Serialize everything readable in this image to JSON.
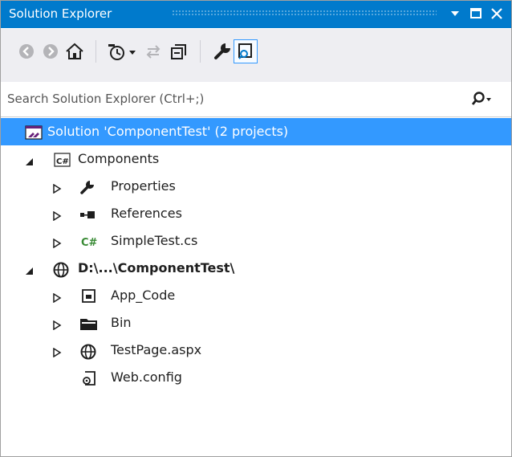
{
  "window": {
    "title": "Solution Explorer",
    "accent_color": "#007acc",
    "selection_color": "#3399ff"
  },
  "title_buttons": [
    {
      "name": "dropdown-arrow-icon"
    },
    {
      "name": "maximize-icon"
    },
    {
      "name": "close-icon"
    }
  ],
  "toolbar": {
    "buttons": [
      {
        "name": "back-icon"
      },
      {
        "name": "forward-icon"
      },
      {
        "name": "home-icon"
      },
      {
        "name": "pending-changes-filter-icon"
      },
      {
        "name": "sync-with-active-document-icon"
      },
      {
        "name": "collapse-all-icon"
      },
      {
        "name": "properties-wrench-icon"
      },
      {
        "name": "preview-selected-items-icon"
      }
    ]
  },
  "search": {
    "placeholder": "Search Solution Explorer (Ctrl+;)",
    "icon": "search-icon"
  },
  "tree": {
    "solution": {
      "label": "Solution 'ComponentTest' (2 projects)",
      "icon": "solution-icon",
      "selected": true
    },
    "projects": [
      {
        "label": "Components",
        "icon": "csharp-project-icon",
        "expanded": true,
        "children": [
          {
            "label": "Properties",
            "icon": "wrench-icon",
            "expandable": true
          },
          {
            "label": "References",
            "icon": "references-icon",
            "expandable": true
          },
          {
            "label": "SimpleTest.cs",
            "icon": "csharp-file-icon",
            "expandable": true
          }
        ]
      },
      {
        "label": "D:\\...\\ComponentTest\\",
        "icon": "website-globe-icon",
        "expanded": true,
        "children": [
          {
            "label": "App_Code",
            "icon": "app-code-folder-icon",
            "expandable": true
          },
          {
            "label": "Bin",
            "icon": "folder-icon",
            "expandable": true
          },
          {
            "label": "TestPage.aspx",
            "icon": "globe-icon",
            "expandable": true
          },
          {
            "label": "Web.config",
            "icon": "config-file-icon",
            "expandable": false
          }
        ]
      }
    ]
  }
}
